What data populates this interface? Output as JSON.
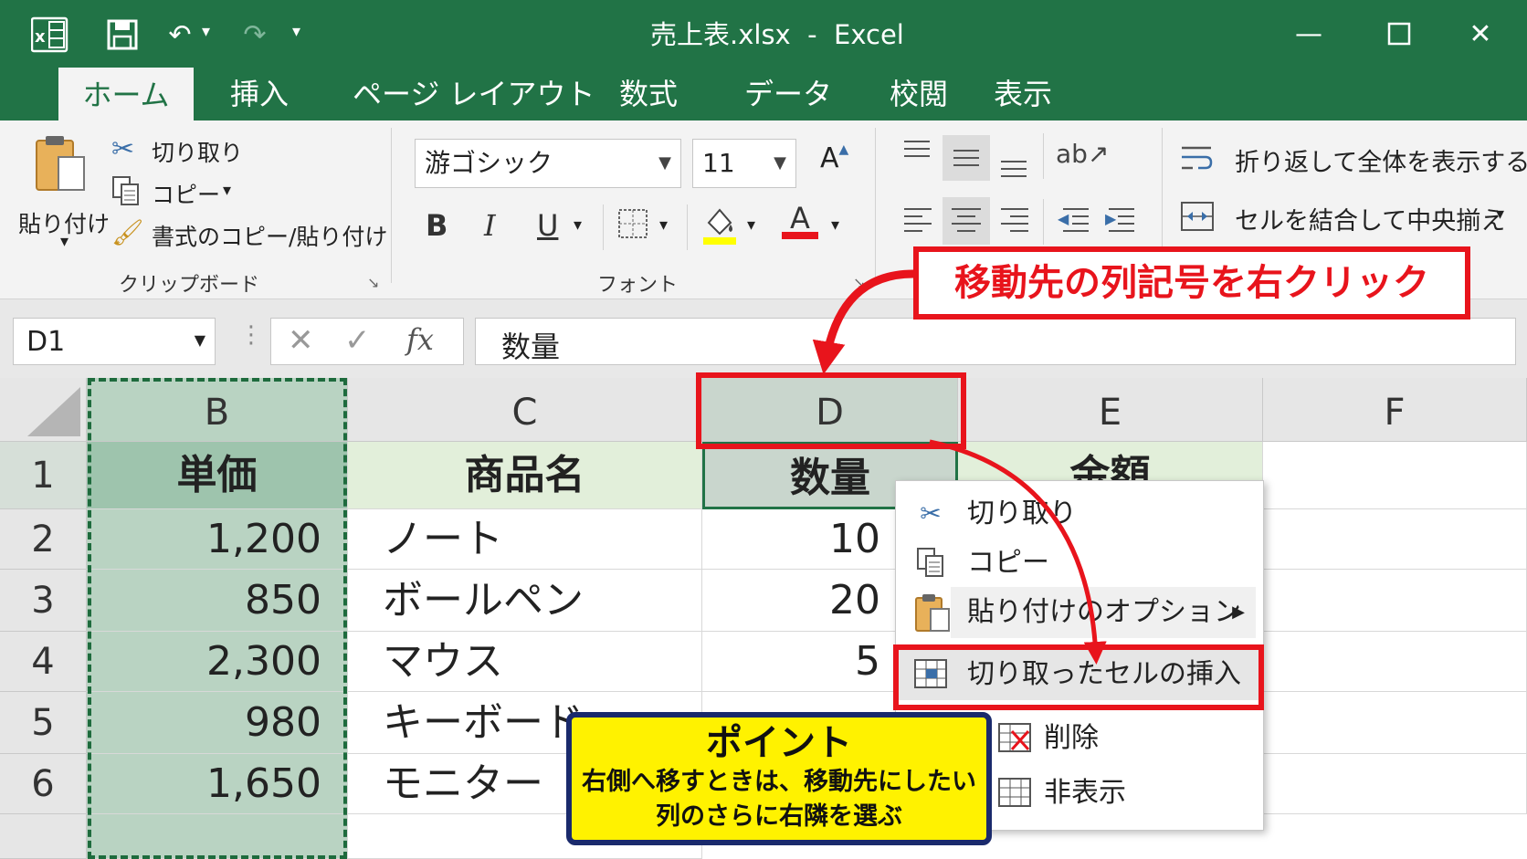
{
  "window": {
    "title": "売上表.xlsx  -  Excel",
    "app_icon": "excel-icon"
  },
  "tabs": [
    "ホーム",
    "挿入",
    "ページ レイアウト",
    "数式",
    "データ",
    "校閲",
    "表示"
  ],
  "ribbon": {
    "clipboard": {
      "paste": "貼り付け",
      "cut": "切り取り",
      "copy": "コピー",
      "format_painter": "書式のコピー/貼り付け",
      "group_label": "クリップボード"
    },
    "font": {
      "font_name": "游ゴシック",
      "font_size": "11",
      "grow": "A",
      "bold": "B",
      "italic": "I",
      "underline": "U",
      "font_color": "A",
      "group_label": "フォント"
    },
    "alignment": {
      "wrap_text": "折り返して全体を表示する",
      "merge_center": "セルを結合して中央揃え"
    }
  },
  "formula_bar": {
    "name_box": "D1",
    "fx": "fx",
    "value": "数量"
  },
  "sheet": {
    "columns": [
      "B",
      "C",
      "D",
      "E",
      "F"
    ],
    "rows": [
      "1",
      "2",
      "3",
      "4",
      "5",
      "6"
    ],
    "header": {
      "B": "単価",
      "C": "商品名",
      "D": "数量",
      "E": "金額"
    },
    "data": [
      {
        "B": "1,200",
        "C": "ノート",
        "D": "10"
      },
      {
        "B": "850",
        "C": "ボールペン",
        "D": "20"
      },
      {
        "B": "2,300",
        "C": "マウス",
        "D": "5"
      },
      {
        "B": "980",
        "C": "キーボード",
        "D": ""
      },
      {
        "B": "1,650",
        "C": "モニター",
        "D": ""
      }
    ]
  },
  "context_menu": {
    "cut": "切り取り",
    "copy": "コピー",
    "paste_options": "貼り付けのオプション",
    "insert_cut_cells": "切り取ったセルの挿入",
    "delete": "削除",
    "hide": "非表示"
  },
  "annotations": {
    "callout": "移動先の列記号を右クリック",
    "point_title": "ポイント",
    "point_line1": "右側へ移すときは、移動先にしたい",
    "point_line2": "列のさらに右隣を選ぶ"
  },
  "colors": {
    "excel_green": "#217346",
    "annotation_red": "#e8141c",
    "point_yellow": "#fff200",
    "point_border": "#1a2a6c"
  }
}
